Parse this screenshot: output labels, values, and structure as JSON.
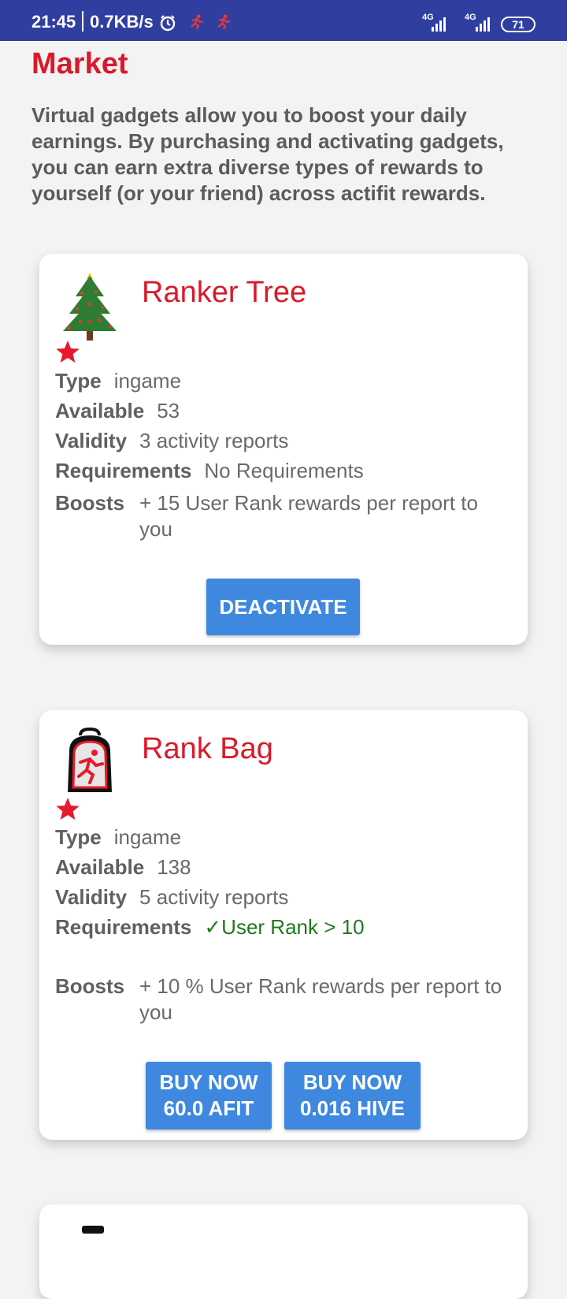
{
  "status_bar": {
    "time": "21:45",
    "speed": "0.7KB/s",
    "network_1": "4G",
    "network_2": "4G",
    "battery": "71"
  },
  "page": {
    "title": "Market",
    "intro": "Virtual gadgets allow you to boost your daily earnings. By purchasing and activating gadgets, you can earn extra diverse types of rewards to yourself (or your friend) across actifit rewards."
  },
  "labels": {
    "type": "Type",
    "available": "Available",
    "validity": "Validity",
    "requirements": "Requirements",
    "boosts": "Boosts"
  },
  "gadgets": [
    {
      "name": "Ranker Tree",
      "type": "ingame",
      "available": "53",
      "validity": "3 activity reports",
      "requirements": "No Requirements",
      "boosts": "+ 15 User Rank rewards per report to you",
      "action": "DEACTIVATE"
    },
    {
      "name": "Rank Bag",
      "type": "ingame",
      "available": "138",
      "validity": "5 activity reports",
      "requirements": "✓User Rank > 10",
      "boosts": "+ 10 % User Rank rewards per report to you",
      "buy_afit_line1": "BUY NOW",
      "buy_afit_line2": "60.0 AFIT",
      "buy_hive_line1": "BUY NOW",
      "buy_hive_line2": "0.016 HIVE"
    }
  ],
  "colors": {
    "status_bar": "#303f9f",
    "accent_red": "#d91a2a",
    "button_blue": "#3f88e0",
    "requirement_ok": "#1e7a1e"
  }
}
